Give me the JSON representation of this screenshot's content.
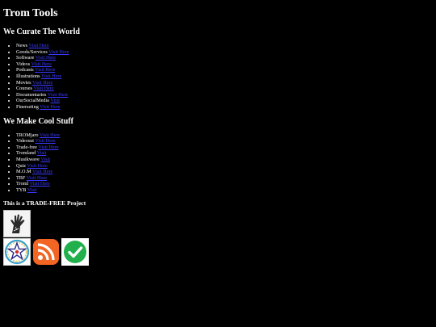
{
  "page_title": "Trom Tools",
  "curate": {
    "heading": "We Curate The World",
    "items": [
      {
        "label": "News",
        "link": "Visit Here"
      },
      {
        "label": "Goods/Services",
        "link": "Visit Here"
      },
      {
        "label": "Software",
        "link": "Visit Here"
      },
      {
        "label": "Videos",
        "link": "Visit Here"
      },
      {
        "label": "Podcasts",
        "link": "Visit Here"
      },
      {
        "label": "Illustrations",
        "link": "Visit Here"
      },
      {
        "label": "Movies",
        "link": "Visit Here"
      },
      {
        "label": "Courses",
        "link": "Visit Here"
      },
      {
        "label": "Documentaries",
        "link": "Visit Here"
      },
      {
        "label": "OurSocialMedia",
        "link": "Visit"
      },
      {
        "label": "Finerseting",
        "link": "Visit Here"
      }
    ]
  },
  "cool": {
    "heading": "We Make Cool Stuff",
    "items": [
      {
        "label": "TROMjaro",
        "link": "Visit Here"
      },
      {
        "label": "Videosut",
        "link": "Visit Here"
      },
      {
        "label": "Trade-free",
        "link": "Visit Here"
      },
      {
        "label": "Tromland",
        "link": "Visit"
      },
      {
        "label": "Musikwave",
        "link": "Visit"
      },
      {
        "label": "Quiz",
        "link": "Visit Here"
      },
      {
        "label": "M.O.M",
        "link": "Visit Here"
      },
      {
        "label": "TBF",
        "link": "Visit Here"
      },
      {
        "label": "Troml",
        "link": "Visit Here"
      },
      {
        "label": "TYB",
        "link": "Visit"
      }
    ]
  },
  "project": {
    "heading": "This is a TRADE-FREE Project"
  },
  "badges": {
    "row1": [
      {
        "icon": "hand-icon",
        "name": "tradefree-hand-badge"
      }
    ],
    "row2": [
      {
        "icon": "star-wreath-icon",
        "name": "star-badge"
      },
      {
        "icon": "rss-icon",
        "name": "rss-badge"
      },
      {
        "icon": "checkmark-icon",
        "name": "check-badge"
      }
    ]
  },
  "colors": {
    "background": "#000000",
    "text": "#ffffff",
    "link": "#3a3aff",
    "rss": "#f26522",
    "check": "#21b04b"
  }
}
